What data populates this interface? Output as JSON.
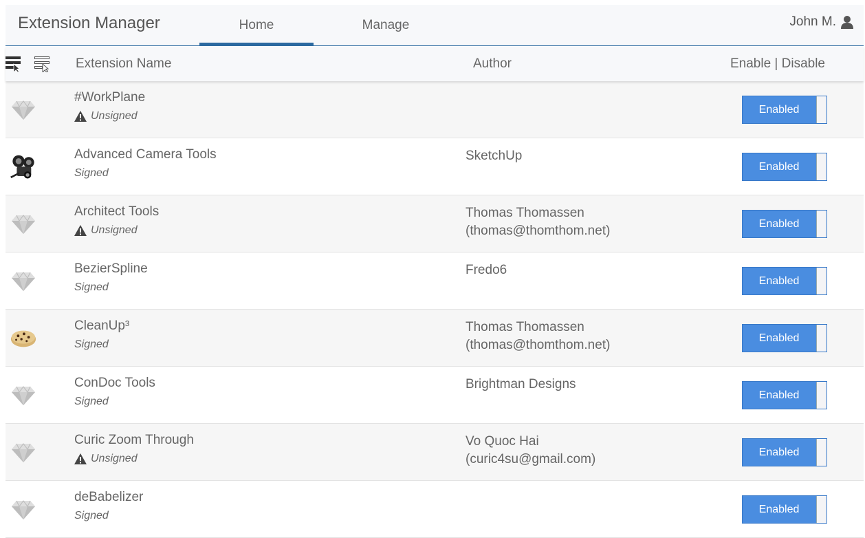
{
  "header": {
    "title": "Extension Manager",
    "tabs": [
      {
        "label": "Home",
        "active": true
      },
      {
        "label": "Manage",
        "active": false
      }
    ],
    "user": "John M."
  },
  "columns": {
    "name": "Extension Name",
    "author": "Author",
    "toggle": "Enable | Disable"
  },
  "rows": [
    {
      "name": "#WorkPlane",
      "signature": "Unsigned",
      "warning": true,
      "author_line1": "",
      "author_line2": "",
      "icon": "gem-icon",
      "toggle": "Enabled"
    },
    {
      "name": "Advanced Camera Tools",
      "signature": "Signed",
      "warning": false,
      "author_line1": "SketchUp",
      "author_line2": "",
      "icon": "camera-icon",
      "toggle": "Enabled"
    },
    {
      "name": "Architect Tools",
      "signature": "Unsigned",
      "warning": true,
      "author_line1": "Thomas Thomassen",
      "author_line2": "(thomas@thomthom.net)",
      "icon": "gem-icon",
      "toggle": "Enabled"
    },
    {
      "name": "BezierSpline",
      "signature": "Signed",
      "warning": false,
      "author_line1": "Fredo6",
      "author_line2": "",
      "icon": "gem-icon",
      "toggle": "Enabled"
    },
    {
      "name": "CleanUp³",
      "signature": "Signed",
      "warning": false,
      "author_line1": "Thomas Thomassen",
      "author_line2": "(thomas@thomthom.net)",
      "icon": "cookie-icon",
      "toggle": "Enabled"
    },
    {
      "name": "ConDoc Tools",
      "signature": "Signed",
      "warning": false,
      "author_line1": "Brightman Designs",
      "author_line2": "",
      "icon": "gem-icon",
      "toggle": "Enabled"
    },
    {
      "name": "Curic Zoom Through",
      "signature": "Unsigned",
      "warning": true,
      "author_line1": "Vo Quoc Hai",
      "author_line2": "(curic4su@gmail.com)",
      "icon": "gem-icon",
      "toggle": "Enabled"
    },
    {
      "name": "deBabelizer",
      "signature": "Signed",
      "warning": false,
      "author_line1": "",
      "author_line2": "",
      "icon": "gem-icon",
      "toggle": "Enabled"
    }
  ],
  "colors": {
    "accent": "#2c6aa0",
    "toggle_on": "#4a8de0"
  }
}
